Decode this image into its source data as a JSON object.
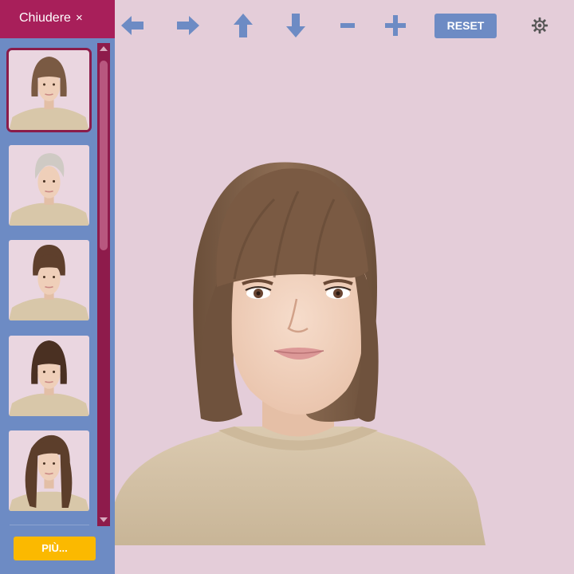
{
  "sidebar": {
    "close_label": "Chiudere",
    "close_icon": "×",
    "more_label": "PIÙ..."
  },
  "toolbar": {
    "reset_label": "RESET"
  },
  "hairstyles": [
    {
      "id": "bob-brown-bangs",
      "hair": "#7a5a43",
      "selected": true
    },
    {
      "id": "pixie-platinum",
      "hair": "#cfcac4",
      "selected": false
    },
    {
      "id": "bowl-cut-brown",
      "hair": "#5e3f2c",
      "selected": false
    },
    {
      "id": "short-bob-dark",
      "hair": "#4a3022",
      "selected": false
    },
    {
      "id": "long-wavy-brown",
      "hair": "#5c3e2b",
      "selected": false
    }
  ],
  "colors": {
    "background": "#e4cdd9",
    "sidebar": "#6d8bc4",
    "accent": "#a81f5a",
    "more_button": "#fbb900",
    "tool_icon": "#6d8bc4"
  }
}
